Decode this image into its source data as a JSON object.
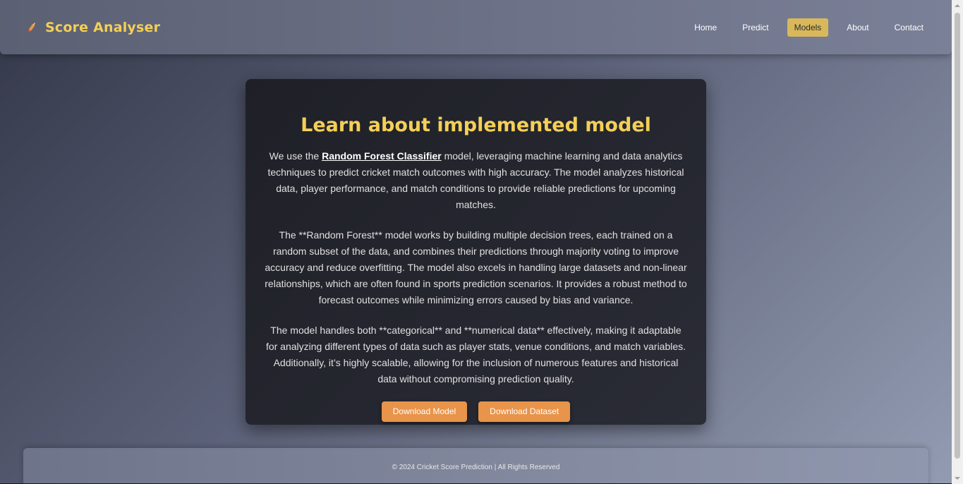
{
  "brand": {
    "title": "Score Analyser",
    "icon": "cricket-bat-icon",
    "accent_color": "#f4cf57"
  },
  "nav": {
    "items": [
      {
        "label": "Home",
        "active": false
      },
      {
        "label": "Predict",
        "active": false
      },
      {
        "label": "Models",
        "active": true
      },
      {
        "label": "About",
        "active": false
      },
      {
        "label": "Contact",
        "active": false
      }
    ],
    "active_color": "#d9b85b"
  },
  "content": {
    "title": "Learn about implemented model",
    "para1": {
      "before": "We use the ",
      "link": "Random Forest Classifier",
      "after": " model, leveraging machine learning and data analytics techniques to predict cricket match outcomes with high accuracy. The model analyzes historical data, player performance, and match conditions to provide reliable predictions for upcoming matches."
    },
    "para2": "The **Random Forest** model works by building multiple decision trees, each trained on a random subset of the data, and combines their predictions through majority voting to improve accuracy and reduce overfitting. The model also excels in handling large datasets and non-linear relationships, which are often found in sports prediction scenarios. It provides a robust method to forecast outcomes while minimizing errors caused by bias and variance.",
    "para3": "The model handles both **categorical** and **numerical data** effectively, making it adaptable for analyzing different types of data such as player stats, venue conditions, and match variables. Additionally, it’s highly scalable, allowing for the inclusion of numerous features and historical data without compromising prediction quality.",
    "download_model_label": "Download Model",
    "download_dataset_label": "Download Dataset",
    "button_color": "#e8944a"
  },
  "footer": {
    "text": "© 2024 Cricket Score Prediction | All Rights Reserved"
  }
}
